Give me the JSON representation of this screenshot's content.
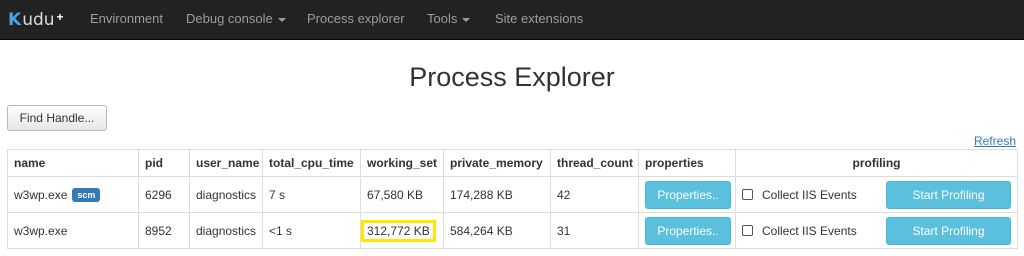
{
  "nav": {
    "brand": {
      "mark": "K",
      "text": "udu",
      "plus": "+"
    },
    "items": [
      {
        "label": "Environment",
        "dropdown": false
      },
      {
        "label": "Debug console",
        "dropdown": true
      },
      {
        "label": "Process explorer",
        "dropdown": false
      },
      {
        "label": "Tools",
        "dropdown": true
      },
      {
        "label": "Site extensions",
        "dropdown": false
      }
    ]
  },
  "page": {
    "title": "Process Explorer",
    "find_handle_label": "Find Handle...",
    "refresh_label": "Refresh"
  },
  "table": {
    "headers": [
      "name",
      "pid",
      "user_name",
      "total_cpu_time",
      "working_set",
      "private_memory",
      "thread_count",
      "properties",
      "profiling"
    ],
    "rows": [
      {
        "name": "w3wp.exe",
        "badge": "scm",
        "pid": "6296",
        "user_name": "diagnostics",
        "total_cpu_time": "7 s",
        "working_set": "67,580 KB",
        "private_memory": "174,288 KB",
        "thread_count": "42",
        "properties_label": "Properties..",
        "collect_label": "Collect IIS Events",
        "profile_label": "Start Profiling"
      },
      {
        "name": "w3wp.exe",
        "badge": "",
        "pid": "8952",
        "user_name": "diagnostics",
        "total_cpu_time": "<1 s",
        "working_set": "312,772 KB",
        "private_memory": "584,264 KB",
        "thread_count": "31",
        "properties_label": "Properties..",
        "collect_label": "Collect IIS Events",
        "profile_label": "Start Profiling"
      }
    ]
  },
  "colors": {
    "navbar": "#222222",
    "nav_text": "#9d9d9d",
    "brand_accent": "#4aa3df",
    "info_button": "#5bc0de",
    "badge": "#337ab7",
    "highlight": "#ffe800"
  }
}
